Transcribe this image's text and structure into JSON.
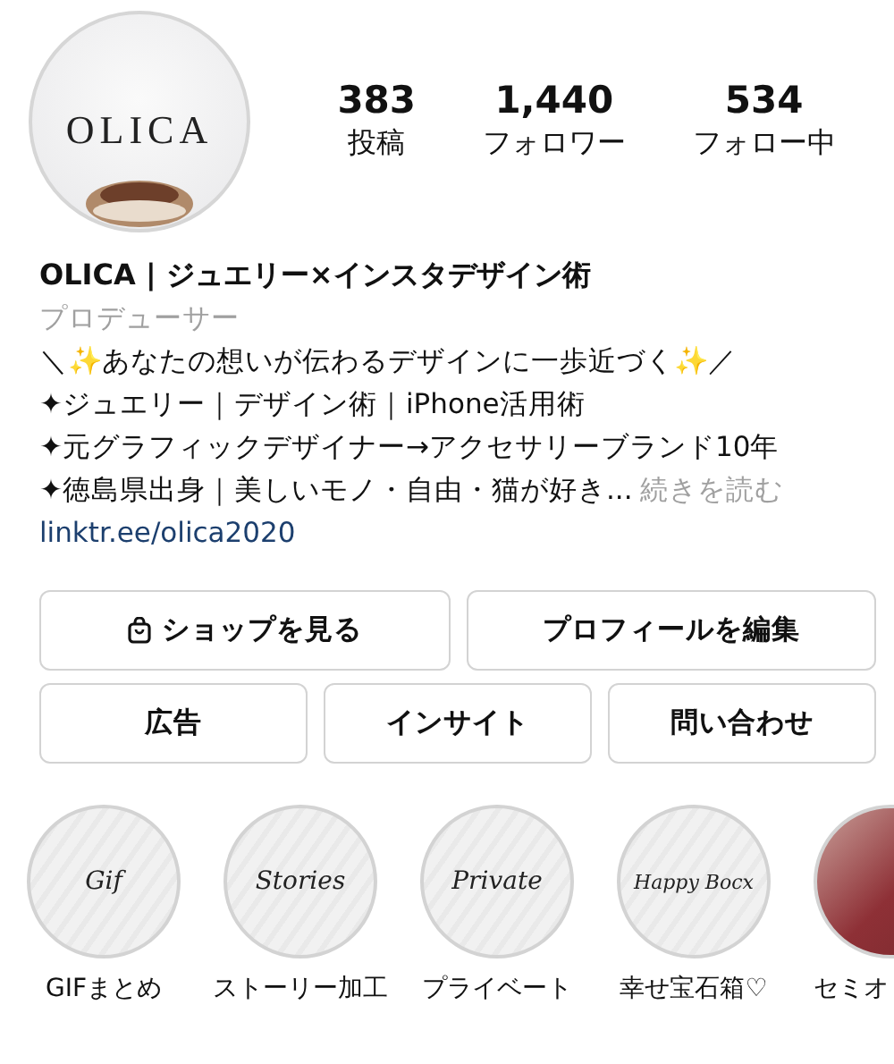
{
  "avatar": {
    "logo": "OLICA"
  },
  "stats": [
    {
      "value": "383",
      "label": "投稿"
    },
    {
      "value": "1,440",
      "label": "フォロワー"
    },
    {
      "value": "534",
      "label": "フォロー中"
    }
  ],
  "bio": {
    "name": "OLICA | ジュエリー×インスタデザイン術",
    "category": "プロデューサー",
    "lines": [
      "＼✨あなたの想いが伝わるデザインに一歩近づく✨／",
      "✦ジュエリー｜デザイン術｜iPhone活用術",
      "✦元グラフィックデザイナー→アクセサリーブランド10年",
      "✦徳島県出身｜美しいモノ・自由・猫が好き..."
    ],
    "more": "続きを読む",
    "link": "linktr.ee/olica2020"
  },
  "buttons": [
    [
      {
        "label": "ショップを見る",
        "kind": "shop"
      },
      {
        "label": "プロフィールを編集",
        "kind": "plain"
      }
    ],
    [
      {
        "label": "広告",
        "kind": "plain"
      },
      {
        "label": "インサイト",
        "kind": "plain"
      },
      {
        "label": "問い合わせ",
        "kind": "plain"
      }
    ]
  ],
  "highlights": [
    {
      "kind": "text",
      "cover": "Gif",
      "label": "GIFまとめ"
    },
    {
      "kind": "text",
      "cover": "Stories",
      "label": "ストーリー加工"
    },
    {
      "kind": "text",
      "cover": "Private",
      "label": "プライベート"
    },
    {
      "kind": "text",
      "cover": "Happy Bocx",
      "label": "幸せ宝石箱♡"
    },
    {
      "kind": "photo",
      "label": "セミオ"
    }
  ]
}
